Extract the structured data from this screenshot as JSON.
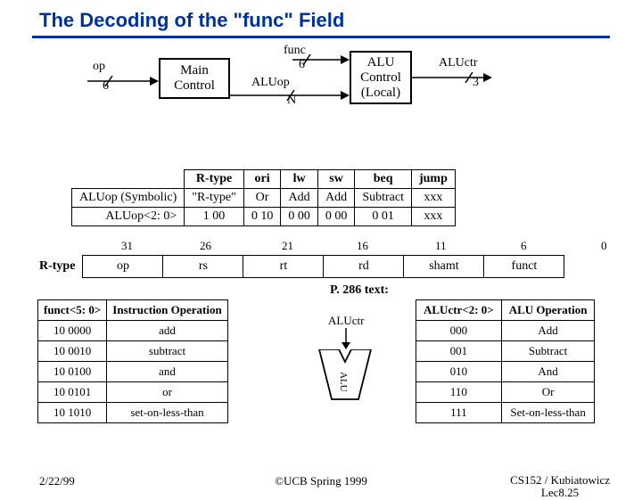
{
  "title": "The Decoding of the \"func\" Field",
  "diagram": {
    "op": "op",
    "op_w": "6",
    "main": "Main\nControl",
    "aluop": "ALUop",
    "aluop_n": "N",
    "func": "func",
    "func_w": "6",
    "aluctl": "ALU\nControl\n(Local)",
    "aluctr": "ALUctr",
    "aluctr_w": "3"
  },
  "tbl1": {
    "rowhdr": [
      "ALUop (Symbolic)",
      "ALUop<2: 0>"
    ],
    "cols": [
      "R-type",
      "ori",
      "lw",
      "sw",
      "beq",
      "jump"
    ],
    "r1": [
      "\"R-type\"",
      "Or",
      "Add",
      "Add",
      "Subtract",
      "xxx"
    ],
    "r2": [
      "1 00",
      "0 10",
      "0 00",
      "0 00",
      "0 01",
      "xxx"
    ]
  },
  "bits": [
    "31",
    "26",
    "21",
    "16",
    "11",
    "6",
    "0"
  ],
  "fmt": {
    "label": "R-type",
    "f": [
      "op",
      "rs",
      "rt",
      "rd",
      "shamt",
      "funct"
    ]
  },
  "ptext": "P. 286 text:",
  "tbl2": {
    "h": [
      "funct<5: 0>",
      "Instruction Operation"
    ],
    "rows": [
      [
        "10 0000",
        "add"
      ],
      [
        "10 0010",
        "subtract"
      ],
      [
        "10 0100",
        "and"
      ],
      [
        "10 0101",
        "or"
      ],
      [
        "10 1010",
        "set-on-less-than"
      ]
    ]
  },
  "aluctr2": "ALUctr",
  "alu_text": "ALU",
  "tbl3": {
    "h": [
      "ALUctr<2: 0>",
      "ALU Operation"
    ],
    "rows": [
      [
        "000",
        "Add"
      ],
      [
        "001",
        "Subtract"
      ],
      [
        "010",
        "And"
      ],
      [
        "110",
        "Or"
      ],
      [
        "111",
        "Set-on-less-than"
      ]
    ]
  },
  "footer": {
    "date": "2/22/99",
    "copy": "©UCB Spring 1999",
    "ref1": "CS152 / Kubiatowicz",
    "ref2": "Lec8.25"
  }
}
